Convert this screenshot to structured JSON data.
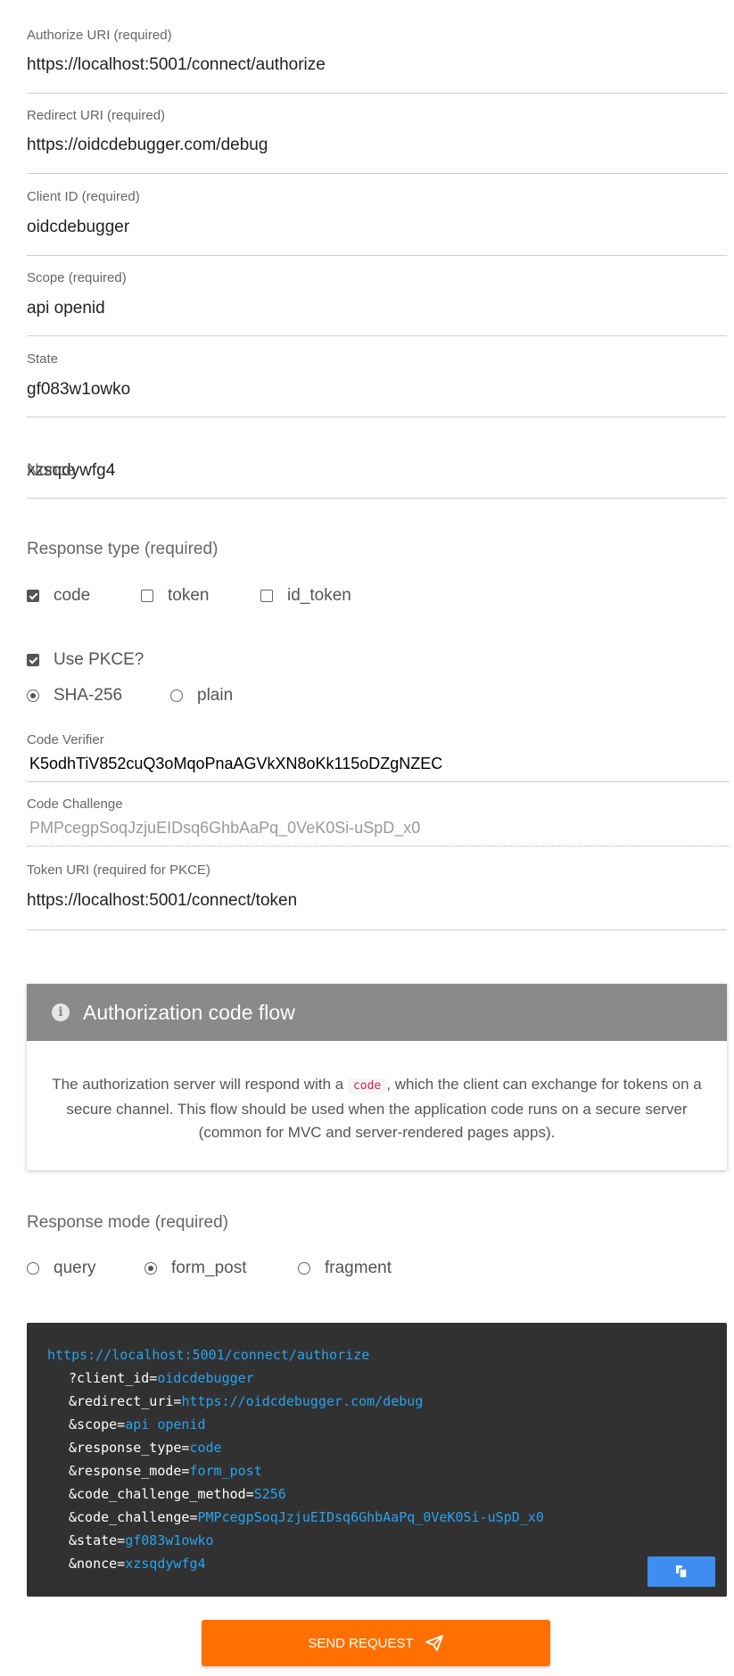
{
  "fields": {
    "authorize_uri": {
      "label": "Authorize URI (required)",
      "value": "https://localhost:5001/connect/authorize"
    },
    "redirect_uri": {
      "label": "Redirect URI (required)",
      "value": "https://oidcdebugger.com/debug"
    },
    "client_id": {
      "label": "Client ID (required)",
      "value": "oidcdebugger"
    },
    "scope": {
      "label": "Scope (required)",
      "value": "api openid"
    },
    "state": {
      "label": "State",
      "value": "gf083w1owko"
    },
    "nonce": {
      "value": "xzsqdywfg4",
      "ghost_value": "Nonce"
    }
  },
  "response_type": {
    "title": "Response type (required)",
    "options": [
      {
        "label": "code",
        "checked": true
      },
      {
        "label": "token",
        "checked": false
      },
      {
        "label": "id_token",
        "checked": false
      }
    ]
  },
  "pkce": {
    "use_label": "Use PKCE?",
    "use_checked": true,
    "methods": [
      {
        "label": "SHA-256",
        "selected": true
      },
      {
        "label": "plain",
        "selected": false
      }
    ],
    "code_verifier": {
      "label": "Code Verifier",
      "value": "K5odhTiV852cuQ3oMqoPnaAGVkXN8oKk115oDZgNZEC"
    },
    "code_challenge": {
      "label": "Code Challenge",
      "value": "PMPcegpSoqJzjuEIDsq6GhbAaPq_0VeK0Si-uSpD_x0"
    },
    "token_uri": {
      "label": "Token URI (required for PKCE)",
      "value": "https://localhost:5001/connect/token"
    }
  },
  "info_card": {
    "title": "Authorization code flow",
    "text_before": "The authorization server will respond with a",
    "code": "code",
    "text_line1_after": ", which the client can exchange for tokens on a",
    "text_line2": "secure channel. This flow should be used when the application code runs on a secure server",
    "text_line3": "(common for MVC and server-rendered pages apps).",
    "icon": "info-icon"
  },
  "response_mode": {
    "title": "Response mode (required)",
    "options": [
      {
        "label": "query",
        "selected": false
      },
      {
        "label": "form_post",
        "selected": true
      },
      {
        "label": "fragment",
        "selected": false
      }
    ]
  },
  "request_url": {
    "base": "https://localhost:5001/connect/authorize",
    "params": [
      {
        "key": "?client_id=",
        "value": "oidcdebugger"
      },
      {
        "key": "&redirect_uri=",
        "value": "https://oidcdebugger.com/debug"
      },
      {
        "key": "&scope=",
        "value": "api openid"
      },
      {
        "key": "&response_type=",
        "value": "code"
      },
      {
        "key": "&response_mode=",
        "value": "form_post"
      },
      {
        "key": "&code_challenge_method=",
        "value": "S256"
      },
      {
        "key": "&code_challenge=",
        "value": "PMPcegpSoqJzjuEIDsq6GhbAaPq_0VeK0Si-uSpD_x0"
      },
      {
        "key": "&state=",
        "value": "gf083w1owko"
      },
      {
        "key": "&nonce=",
        "value": "xzsqdywfg4"
      }
    ],
    "copy_icon": "copy-icon"
  },
  "send_button": {
    "label": "SEND REQUEST",
    "icon": "paper-plane-icon"
  },
  "colors": {
    "accent_orange": "#ff7000",
    "code_bg": "#313131",
    "code_value": "#29a3f0",
    "card_header": "#8a8a8a",
    "copy_button": "#3d8ef0"
  }
}
